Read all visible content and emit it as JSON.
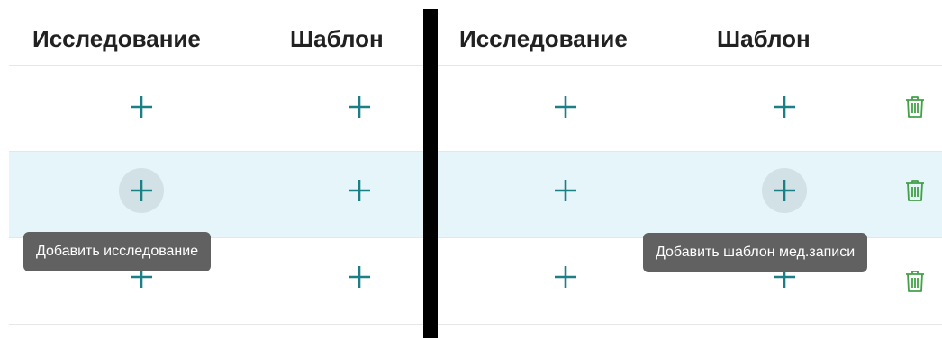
{
  "left_table": {
    "columns": [
      "Исследование",
      "Шаблон"
    ],
    "rows": [
      {
        "study_action": "+",
        "template_action": "+"
      },
      {
        "study_action": "+",
        "template_action": "+"
      },
      {
        "study_action": "+",
        "template_action": "+"
      }
    ],
    "tooltip": "Добавить исследование"
  },
  "right_table": {
    "columns": [
      "Исследование",
      "Шаблон"
    ],
    "rows": [
      {
        "study_action": "+",
        "template_action": "+",
        "delete_icon": "trash-icon"
      },
      {
        "study_action": "+",
        "template_action": "+",
        "delete_icon": "trash-icon"
      },
      {
        "study_action": "+",
        "template_action": "+",
        "delete_icon": "trash-icon"
      }
    ],
    "tooltip": "Добавить шаблон мед.записи"
  },
  "colors": {
    "accent": "#1b7f86",
    "row_highlight": "#e6f5fa",
    "tooltip_bg": "#616161",
    "trash": "#43a047",
    "divider": "#000000"
  },
  "highlighted_row": 2
}
